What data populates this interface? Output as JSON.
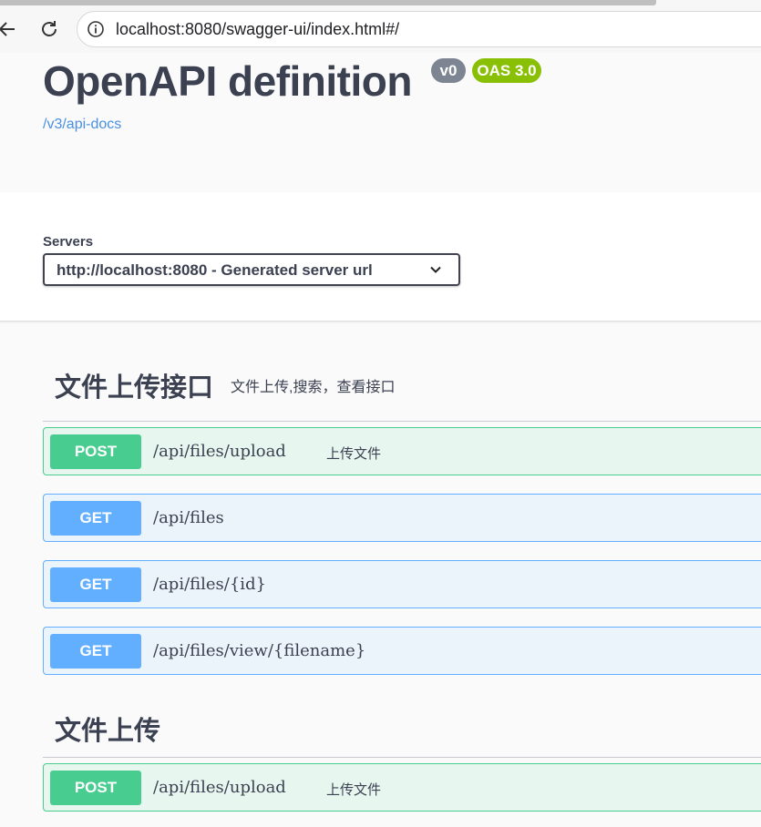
{
  "browser": {
    "url": "localhost:8080/swagger-ui/index.html#/"
  },
  "info": {
    "title": "OpenAPI definition",
    "version_badge": "v0",
    "oas_badge": "OAS 3.0",
    "docs_link": "/v3/api-docs"
  },
  "servers": {
    "label": "Servers",
    "selected": "http://localhost:8080 - Generated server url"
  },
  "tags": [
    {
      "name": "文件上传接口",
      "description": "文件上传,搜索，查看接口",
      "operations": [
        {
          "method": "POST",
          "path": "/api/files/upload",
          "summary": "上传文件"
        },
        {
          "method": "GET",
          "path": "/api/files",
          "summary": ""
        },
        {
          "method": "GET",
          "path": "/api/files/{id}",
          "summary": ""
        },
        {
          "method": "GET",
          "path": "/api/files/view/{filename}",
          "summary": ""
        }
      ]
    },
    {
      "name": "文件上传",
      "description": "",
      "operations": [
        {
          "method": "POST",
          "path": "/api/files/upload",
          "summary": "上传文件"
        }
      ]
    }
  ],
  "colors": {
    "post": "#49cc90",
    "get": "#61affe",
    "version_badge": "#7d8492",
    "oas_badge": "#89bf04",
    "link": "#4990e2"
  }
}
